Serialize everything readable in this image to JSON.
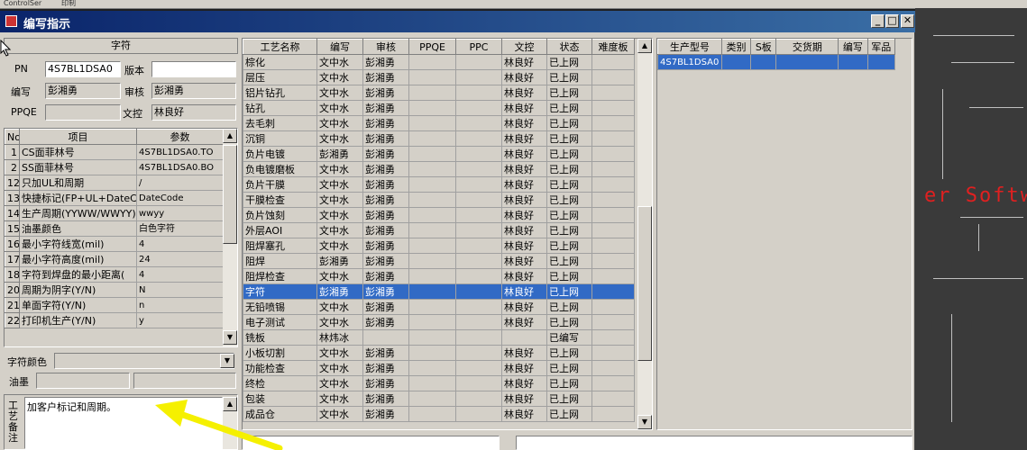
{
  "background": {
    "toolbar_labels": [
      "ControlSer",
      "印制"
    ],
    "watermark_text": "er Softw"
  },
  "window": {
    "title": "编写指示",
    "icon": "app-icon",
    "controls": [
      "minimize-icon",
      "maximize-icon",
      "close-icon"
    ]
  },
  "left": {
    "section_title": "字符",
    "pn_label": "PN",
    "pn_value": "4S7BL1DSA0",
    "version_label": "版本",
    "version_value": "",
    "writer_label": "编写",
    "writer_value": "彭湘勇",
    "reviewer_label": "审核",
    "reviewer_value": "彭湘勇",
    "ppqe_label": "PPQE",
    "ppqe_value": "",
    "doc_control_label": "文控",
    "doc_control_value": "林良好",
    "param_headers": [
      "No",
      "项目",
      "参数"
    ],
    "params": [
      {
        "no": "1",
        "item": "CS面菲林号",
        "value": "4S7BL1DSA0.TO"
      },
      {
        "no": "2",
        "item": "SS面菲林号",
        "value": "4S7BL1DSA0.BO"
      },
      {
        "no": "12",
        "item": "只加UL和周期",
        "value": "/"
      },
      {
        "no": "13",
        "item": "快捷标记(FP+UL+DateCo",
        "value": "DateCode"
      },
      {
        "no": "14",
        "item": "生产周期(YYWW/WWYY)",
        "value": "wwyy"
      },
      {
        "no": "15",
        "item": "油墨颜色",
        "value": "白色字符"
      },
      {
        "no": "16",
        "item": "最小字符线宽(mil)",
        "value": "4"
      },
      {
        "no": "17",
        "item": "最小字符高度(mil)",
        "value": "24"
      },
      {
        "no": "18",
        "item": "字符到焊盘的最小距离(",
        "value": "4"
      },
      {
        "no": "20",
        "item": "周期为阴字(Y/N)",
        "value": "N"
      },
      {
        "no": "21",
        "item": "单面字符(Y/N)",
        "value": "n"
      },
      {
        "no": "22",
        "item": "打印机生产(Y/N)",
        "value": "y"
      }
    ],
    "char_color_label": "字符颜色",
    "char_color_value": "",
    "ink_label": "油墨",
    "remarks_label": "工艺备注",
    "remarks_text": "加客户标记和周期。"
  },
  "process": {
    "headers": [
      "工艺名称",
      "编写",
      "审核",
      "PPQE",
      "PPC",
      "文控",
      "状态",
      "难度板"
    ],
    "rows": [
      {
        "name": "棕化",
        "writer": "文中水",
        "reviewer": "彭湘勇",
        "ppqe": "",
        "ppc": "",
        "doc": "林良好",
        "status": "已上网"
      },
      {
        "name": "层压",
        "writer": "文中水",
        "reviewer": "彭湘勇",
        "ppqe": "",
        "ppc": "",
        "doc": "林良好",
        "status": "已上网"
      },
      {
        "name": "铝片钻孔",
        "writer": "文中水",
        "reviewer": "彭湘勇",
        "ppqe": "",
        "ppc": "",
        "doc": "林良好",
        "status": "已上网"
      },
      {
        "name": "钻孔",
        "writer": "文中水",
        "reviewer": "彭湘勇",
        "ppqe": "",
        "ppc": "",
        "doc": "林良好",
        "status": "已上网"
      },
      {
        "name": "去毛刺",
        "writer": "文中水",
        "reviewer": "彭湘勇",
        "ppqe": "",
        "ppc": "",
        "doc": "林良好",
        "status": "已上网"
      },
      {
        "name": "沉铜",
        "writer": "文中水",
        "reviewer": "彭湘勇",
        "ppqe": "",
        "ppc": "",
        "doc": "林良好",
        "status": "已上网"
      },
      {
        "name": "负片电镀",
        "writer": "彭湘勇",
        "reviewer": "彭湘勇",
        "ppqe": "",
        "ppc": "",
        "doc": "林良好",
        "status": "已上网"
      },
      {
        "name": "负电镀磨板",
        "writer": "文中水",
        "reviewer": "彭湘勇",
        "ppqe": "",
        "ppc": "",
        "doc": "林良好",
        "status": "已上网"
      },
      {
        "name": "负片干膜",
        "writer": "文中水",
        "reviewer": "彭湘勇",
        "ppqe": "",
        "ppc": "",
        "doc": "林良好",
        "status": "已上网"
      },
      {
        "name": "干膜检查",
        "writer": "文中水",
        "reviewer": "彭湘勇",
        "ppqe": "",
        "ppc": "",
        "doc": "林良好",
        "status": "已上网"
      },
      {
        "name": "负片蚀刻",
        "writer": "文中水",
        "reviewer": "彭湘勇",
        "ppqe": "",
        "ppc": "",
        "doc": "林良好",
        "status": "已上网"
      },
      {
        "name": "外层AOI",
        "writer": "文中水",
        "reviewer": "彭湘勇",
        "ppqe": "",
        "ppc": "",
        "doc": "林良好",
        "status": "已上网"
      },
      {
        "name": "阻焊塞孔",
        "writer": "文中水",
        "reviewer": "彭湘勇",
        "ppqe": "",
        "ppc": "",
        "doc": "林良好",
        "status": "已上网"
      },
      {
        "name": "阻焊",
        "writer": "彭湘勇",
        "reviewer": "彭湘勇",
        "ppqe": "",
        "ppc": "",
        "doc": "林良好",
        "status": "已上网"
      },
      {
        "name": "阻焊检查",
        "writer": "文中水",
        "reviewer": "彭湘勇",
        "ppqe": "",
        "ppc": "",
        "doc": "林良好",
        "status": "已上网"
      },
      {
        "name": "字符",
        "writer": "彭湘勇",
        "reviewer": "彭湘勇",
        "ppqe": "",
        "ppc": "",
        "doc": "林良好",
        "status": "已上网"
      },
      {
        "name": "无铅喷锡",
        "writer": "文中水",
        "reviewer": "彭湘勇",
        "ppqe": "",
        "ppc": "",
        "doc": "林良好",
        "status": "已上网"
      },
      {
        "name": "电子测试",
        "writer": "文中水",
        "reviewer": "彭湘勇",
        "ppqe": "",
        "ppc": "",
        "doc": "林良好",
        "status": "已上网"
      },
      {
        "name": "铣板",
        "writer": "林炜冰",
        "reviewer": "",
        "ppqe": "",
        "ppc": "",
        "doc": "",
        "status": "已编写"
      },
      {
        "name": "小板切割",
        "writer": "文中水",
        "reviewer": "彭湘勇",
        "ppqe": "",
        "ppc": "",
        "doc": "林良好",
        "status": "已上网"
      },
      {
        "name": "功能检查",
        "writer": "文中水",
        "reviewer": "彭湘勇",
        "ppqe": "",
        "ppc": "",
        "doc": "林良好",
        "status": "已上网"
      },
      {
        "name": "终检",
        "writer": "文中水",
        "reviewer": "彭湘勇",
        "ppqe": "",
        "ppc": "",
        "doc": "林良好",
        "status": "已上网"
      },
      {
        "name": "包装",
        "writer": "文中水",
        "reviewer": "彭湘勇",
        "ppqe": "",
        "ppc": "",
        "doc": "林良好",
        "status": "已上网"
      },
      {
        "name": "成品仓",
        "writer": "文中水",
        "reviewer": "彭湘勇",
        "ppqe": "",
        "ppc": "",
        "doc": "林良好",
        "status": "已上网"
      }
    ],
    "selected_row": "字符"
  },
  "production": {
    "headers": [
      "生产型号",
      "类别",
      "S板",
      "交货期",
      "编写",
      "军品"
    ],
    "rows": [
      {
        "model": "4S7BL1DSA0",
        "category": "",
        "s_board": "",
        "delivery": "",
        "writer": "",
        "military": ""
      }
    ]
  },
  "colors": {
    "title_bar": "#0a246a",
    "selection": "#316ac5",
    "window_bg": "#d4d0c8",
    "annotation_arrow": "#f5f000"
  }
}
